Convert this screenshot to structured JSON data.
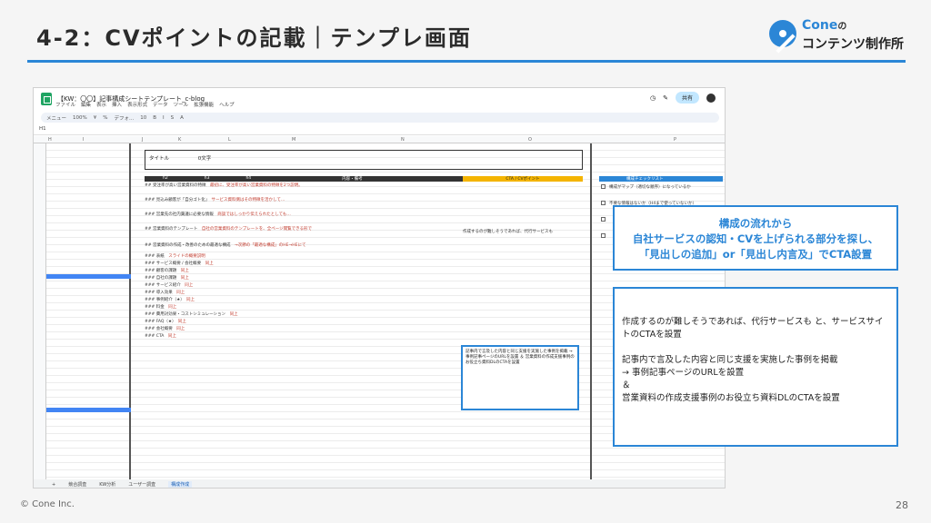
{
  "slide": {
    "title": "4-2：CVポイントの記載｜テンプレ画面",
    "logo_top": "Cone",
    "logo_top_suffix": "の",
    "logo_bottom": "コンテンツ制作所",
    "footer": "© Cone Inc.",
    "page_number": "28",
    "accent_color": "#2b86d6"
  },
  "sheet": {
    "doc_title": "【KW：〇〇】記事構成シートテンプレート_c-blog",
    "menus": [
      "ファイル",
      "編集",
      "表示",
      "挿入",
      "表示形式",
      "データ",
      "ツール",
      "拡張機能",
      "ヘルプ"
    ],
    "share_label": "共有",
    "toolbar": [
      "メニュー",
      "100%",
      "¥",
      "%",
      "デフォ...",
      "10",
      "B",
      "I",
      "S",
      "A"
    ],
    "cell_ref": "H1",
    "col_letters": [
      "H",
      "I",
      "J",
      "K",
      "L",
      "M",
      "N",
      "O",
      "P",
      "Q",
      "R",
      "S",
      "T"
    ],
    "title_cells": [
      "タイトル",
      "0文字"
    ],
    "headers": [
      "h2",
      "h3",
      "h4",
      "内容・備考"
    ],
    "cta_header": "CTA / CVポイント",
    "rows": [
      {
        "a": "## 受注率が高い営業資料の特徴",
        "b": "最初に、受注率が高い営業資料の特徴を2つ説明。",
        "red": true
      },
      {
        "a": "### 見込み顧客が「自分ゴト化」",
        "b": "サービス資料側はその特徴を活かして…",
        "red": true
      },
      {
        "a": "### 営業先の社内稟議に必要な情報",
        "b": "商談ではしっかり伝えられたとしても…",
        "red": true
      },
      {
        "a": "## 営業資料のテンプレート",
        "b": "自社の営業資料のテンプレートを、全ページ閲覧できる形で",
        "red": true
      },
      {
        "a": "## 営業資料の作成・改善のための最適な構成",
        "b": "→次節の「最適な構成」のHE→HEにて",
        "red": true
      },
      {
        "a": "### 表紙",
        "b": "スライドの概要説明",
        "red": true
      },
      {
        "a": "### サービス概要 / 会社概要",
        "b": "同上",
        "red": true
      },
      {
        "a": "### 顧客の課題",
        "b": "同上",
        "red": true
      },
      {
        "a": "### 自社の課題",
        "b": "同上",
        "red": true
      },
      {
        "a": "### サービス紹介",
        "b": "同上",
        "red": true
      },
      {
        "a": "### 導入効果",
        "b": "同上",
        "red": true
      },
      {
        "a": "### 事例紹介（★）",
        "b": "同上",
        "red": true
      },
      {
        "a": "### 料金",
        "b": "同上",
        "red": true
      },
      {
        "a": "### 費用対効果・コストシミュレーション",
        "b": "同上",
        "red": true
      },
      {
        "a": "### FAQ（★）",
        "b": "同上",
        "red": true
      },
      {
        "a": "### 会社概要",
        "b": "同上",
        "red": true
      },
      {
        "a": "### CTA",
        "b": "同上",
        "red": true
      }
    ],
    "cta_cell": "作成するのが難しそうであれば、代行サービスも",
    "cta_box": "記事内で言及した内容と同じ支援を実施した事例を掲載 → 事例記事ページのURLを設置 ＆ 営業資料の作成支援事例のお役立ち資料DLのCTAを設置",
    "check_header": "構成チェックリスト",
    "check_items": [
      "構成がマップ（適切な順序）になっているか",
      "不要な情報はないか（H4まで使っていないか）"
    ],
    "tabs": [
      "競合調査",
      "KW分析",
      "ユーザー調査",
      "構成作成"
    ],
    "active_tab": "構成作成"
  },
  "callout1": {
    "line1": "構成の流れから",
    "line2": "自社サービスの認知・CVを上げられる部分を探し、",
    "line3": "「見出しの追加」or「見出し内言及」でCTA設置"
  },
  "callout2": {
    "p1": "作成するのが難しそうであれば、代行サービスも と、サービスサイトのCTAを設置",
    "p2a": "記事内で言及した内容と同じ支援を実施した事例を掲載",
    "p2b": "→ 事例記事ページのURLを設置",
    "p2c": "＆",
    "p2d": "営業資料の作成支援事例のお役立ち資料DLのCTAを設置"
  }
}
